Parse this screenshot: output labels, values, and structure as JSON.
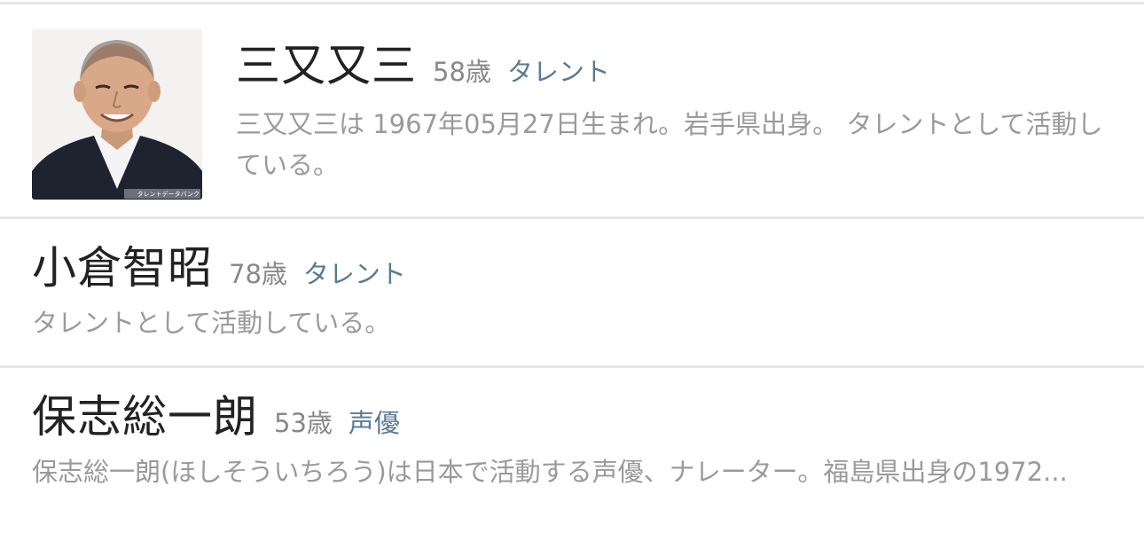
{
  "people": [
    {
      "name": "三又又三",
      "age": "58歳",
      "category": "タレント",
      "description": "三又又三は 1967年05月27日生まれ。岩手県出身。 タレントとして活動している。",
      "photo": {
        "has_photo": true,
        "watermark": "タレントデータバンク"
      }
    },
    {
      "name": "小倉智昭",
      "age": "78歳",
      "category": "タレント",
      "description": "タレントとして活動している。"
    },
    {
      "name": "保志総一朗",
      "age": "53歳",
      "category": "声優",
      "description": "保志総一朗(ほしそういちろう)は日本で活動する声優、ナレーター。福島県出身の1972..."
    }
  ],
  "colors": {
    "name": "#222222",
    "age": "#888888",
    "category": "#5b7a92",
    "description": "#9a9a9a",
    "divider": "#e6e6e6"
  }
}
